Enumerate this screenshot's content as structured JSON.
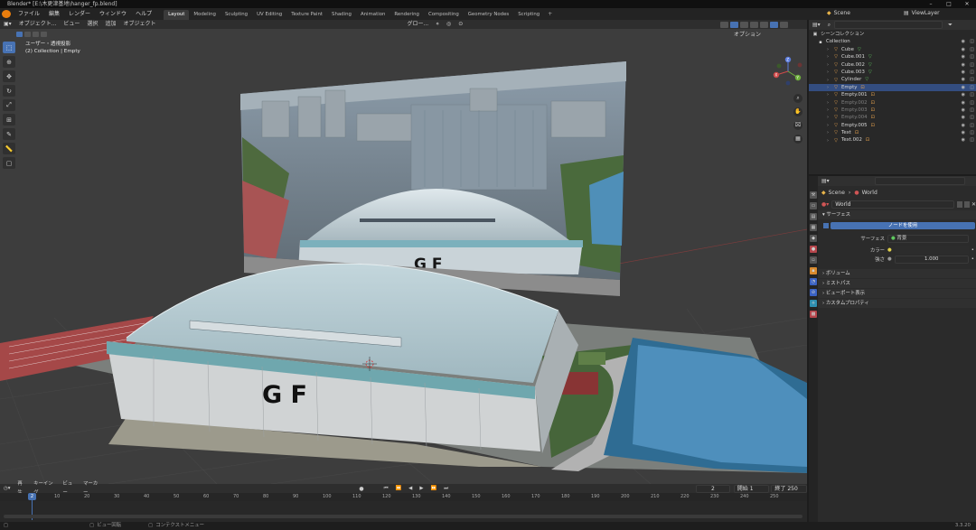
{
  "window": {
    "title": "Blender* [E:\\木更津基地\\hanger_fp.blend]"
  },
  "topbar": {
    "menus": [
      "ファイル",
      "編集",
      "レンダー",
      "ウィンドウ",
      "ヘルプ"
    ],
    "workspaces": [
      "Layout",
      "Modeling",
      "Sculpting",
      "UV Editing",
      "Texture Paint",
      "Shading",
      "Animation",
      "Rendering",
      "Compositing",
      "Geometry Nodes",
      "Scripting"
    ],
    "active_workspace": "Layout",
    "scene": "Scene",
    "view_layer": "ViewLayer"
  },
  "viewport": {
    "mode": "オブジェクト...",
    "menus": [
      "ビュー",
      "選択",
      "追加",
      "オブジェクト"
    ],
    "transform": "グロー...",
    "options": "オプション",
    "info_line1": "ユーザー・透視投影",
    "info_line2": "(2) Collection | Empty",
    "gizmo": {
      "x": "X",
      "y": "Y",
      "z": "Z"
    },
    "photo_label": "G F",
    "model_label": "G F"
  },
  "outliner": {
    "scene_collection": "シーンコレクション",
    "collection": "Collection",
    "items": [
      {
        "name": "Cube",
        "selected": false,
        "dim": false
      },
      {
        "name": "Cube.001",
        "selected": false,
        "dim": false
      },
      {
        "name": "Cube.002",
        "selected": false,
        "dim": false
      },
      {
        "name": "Cube.003",
        "selected": false,
        "dim": false
      },
      {
        "name": "Cylinder",
        "selected": false,
        "dim": false
      },
      {
        "name": "Empty",
        "selected": true,
        "dim": false
      },
      {
        "name": "Empty.001",
        "selected": false,
        "dim": false
      },
      {
        "name": "Empty.002",
        "selected": false,
        "dim": true
      },
      {
        "name": "Empty.003",
        "selected": false,
        "dim": true
      },
      {
        "name": "Empty.004",
        "selected": false,
        "dim": true
      },
      {
        "name": "Empty.005",
        "selected": false,
        "dim": false
      },
      {
        "name": "Text",
        "selected": false,
        "dim": false
      },
      {
        "name": "Text.002",
        "selected": false,
        "dim": false
      }
    ]
  },
  "properties": {
    "breadcrumb_scene": "Scene",
    "breadcrumb_world": "World",
    "world_name": "World",
    "surface_panel": "サーフェス",
    "use_nodes_button": "ノードを使用",
    "surface_label": "サーフェス",
    "surface_value": "背景",
    "color_label": "カラー",
    "strength_label": "強さ",
    "strength_value": "1.000",
    "panels": [
      "ボリューム",
      "ミストパス",
      "ビューポート表示",
      "カスタムプロパティ"
    ]
  },
  "timeline": {
    "menus": [
      "再生",
      "キーイング",
      "ビュー",
      "マーカー"
    ],
    "current_frame": "2",
    "start_label": "開始",
    "start_value": "1",
    "end_label": "終了",
    "end_value": "250",
    "ticks": [
      "10",
      "20",
      "30",
      "40",
      "50",
      "60",
      "70",
      "80",
      "90",
      "100",
      "110",
      "120",
      "130",
      "140",
      "150",
      "160",
      "170",
      "180",
      "190",
      "200",
      "210",
      "220",
      "230",
      "240",
      "250"
    ]
  },
  "statusbar": {
    "hint": "ビュー回転",
    "hint2": "コンテクストメニュー",
    "version": "3.3.20"
  }
}
